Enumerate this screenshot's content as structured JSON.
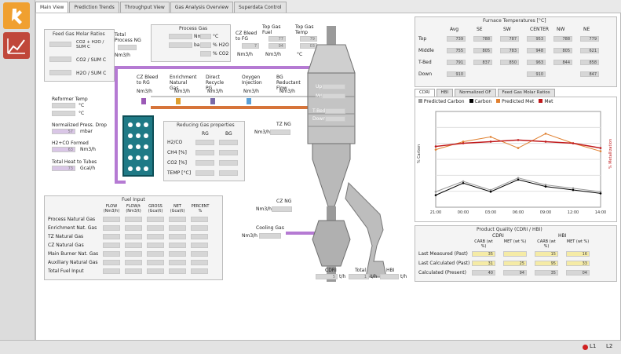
{
  "tabs": [
    "Main View",
    "Prediction Trends",
    "Throughput View",
    "Gas Analysis Overview",
    "Superdata Control"
  ],
  "gas_molar": {
    "title": "Feed Gas Molar Ratios",
    "rows": [
      "CO2 + H2O / SUM C",
      "CO2 / SUM C",
      "H2O / SUM C"
    ]
  },
  "process_gas": {
    "title": "Process Gas",
    "units": [
      "Nm3/h",
      "barg",
      "°C",
      "% H2O",
      "% CO2"
    ]
  },
  "total_process_ng": "Total Process NG",
  "top_labels": {
    "cz_bleed_to_fg": "CZ Bleed to FG",
    "top_gas_fuel": "Top Gas Fuel",
    "top_gas_temp": "Top Gas Temp",
    "top_gas_fuel_val": "77",
    "top_gas_temp_val": "79",
    "cz_val": "7",
    "fuel2_val": "94",
    "temp2_val": "03"
  },
  "units": {
    "nm3h": "Nm3/h",
    "degc": "°C",
    "mbar": "mbar",
    "gcal": "Gcal/h",
    "tph": "t/h"
  },
  "header_row": {
    "cz_bleed_to_rg": "CZ Bleed to RG",
    "enrichment_ng": "Enrichment Natural Gas",
    "direct_recycle": "Direct Recycle PG",
    "oxygen_injection": "Oxygen Injection",
    "bg_reductant": "BG Reductant Flow"
  },
  "reformer": {
    "temp": "Reformer Temp",
    "press_drop": "Normalized Press. Drop",
    "press_val": "57",
    "h2co": "H2+CO Formed",
    "h2co_val": "63",
    "heat": "Total Heat to Tubes",
    "heat_val": "73"
  },
  "reducing": {
    "title": "Reducing Gas properties",
    "cols": [
      "RG",
      "BG"
    ],
    "rows": [
      "H2/CO",
      "CH4 [%]",
      "CO2 [%]",
      "TEMP [°C]"
    ]
  },
  "tz_ng": "TZ NG",
  "cz_ng": "CZ NG",
  "cooling_gas": "Cooling Gas",
  "reactor_labels": [
    "Up",
    "Md",
    "T-Bed",
    "Down"
  ],
  "bottom_labels": {
    "cdri": "CDRI",
    "total": "Total",
    "hbi": "HBI",
    "cdri_val": "5",
    "total_val": "1"
  },
  "fuel_input": {
    "title": "Fuel Input",
    "cols": [
      "FLOW (Nm3/h)",
      "FLOW/t (Nm3/t)",
      "GROSS (Gcal/t)",
      "NET (Gcal/t)",
      "PERCENT %"
    ],
    "rows": [
      "Process Natural Gas",
      "Enrichment Nat. Gas",
      "TZ Natural Gas",
      "CZ Natural Gas",
      "Main Burner Nat. Gas",
      "Auxiliary Natural Gas",
      "Total Fuel Input"
    ]
  },
  "furnace": {
    "title": "Furnace Temperatures [°C]",
    "cols": [
      "Avg",
      "SE",
      "SW",
      "CENTER",
      "NW",
      "NE"
    ],
    "rows": [
      {
        "label": "Top",
        "vals": [
          "739",
          "788",
          "787",
          "953",
          "788",
          "779"
        ]
      },
      {
        "label": "Middle",
        "vals": [
          "755",
          "805",
          "783",
          "948",
          "805",
          "621"
        ]
      },
      {
        "label": "T-Bed",
        "vals": [
          "791",
          "837",
          "850",
          "963",
          "844",
          "858"
        ]
      },
      {
        "label": "Down",
        "vals": [
          "910",
          "",
          "",
          "910",
          "",
          "847"
        ]
      }
    ]
  },
  "chart_tabs": [
    "CDRI",
    "HBI",
    "Normalized OF",
    "Feed Gas Molar Ratios"
  ],
  "chart_legend": [
    "Predicted Carbon",
    "Carbon",
    "Predicted Met",
    "Met"
  ],
  "chart_colors": {
    "carbon": "#000000",
    "pred_carbon": "#9a9a9a",
    "met": "#c0181a",
    "pred_met": "#e08030"
  },
  "chart_data": {
    "type": "line",
    "x": [
      "21:00",
      "00:00",
      "03:00",
      "06:00",
      "09:00",
      "12:00",
      "14:00"
    ],
    "series": [
      {
        "name": "Predicted Carbon",
        "values": [
          1.4,
          2.0,
          1.5,
          2.2,
          1.8,
          1.6,
          1.4
        ]
      },
      {
        "name": "Carbon",
        "values": [
          1.2,
          1.9,
          1.4,
          2.1,
          1.7,
          1.5,
          1.3
        ]
      },
      {
        "name": "Predicted Met",
        "values": [
          93.1,
          93.6,
          93.9,
          93.2,
          94.1,
          93.5,
          93.0
        ]
      },
      {
        "name": "Met",
        "values": [
          93.3,
          93.5,
          93.6,
          93.7,
          93.6,
          93.5,
          93.2
        ]
      }
    ],
    "ylabel": "% Carbon",
    "y2label": "% Metallization"
  },
  "quality": {
    "title": "Product Quality (CDRI / HBI)",
    "groups": [
      "CDRI",
      "HBI"
    ],
    "subcols": [
      "CARB (wt %)",
      "MET (wt %)",
      "CARB (wt %)",
      "MET (wt %)"
    ],
    "rows": [
      {
        "label": "Last Measured (Past)",
        "vals": [
          "35",
          "",
          "15",
          "16"
        ]
      },
      {
        "label": "Last Calculated (Past)",
        "vals": [
          "31",
          "25",
          "95",
          "33"
        ]
      },
      {
        "label": "Calculated (Present)",
        "vals": [
          "40",
          "94",
          "35",
          "04"
        ]
      }
    ]
  },
  "status": {
    "l1": "L1",
    "l2": "L2"
  }
}
